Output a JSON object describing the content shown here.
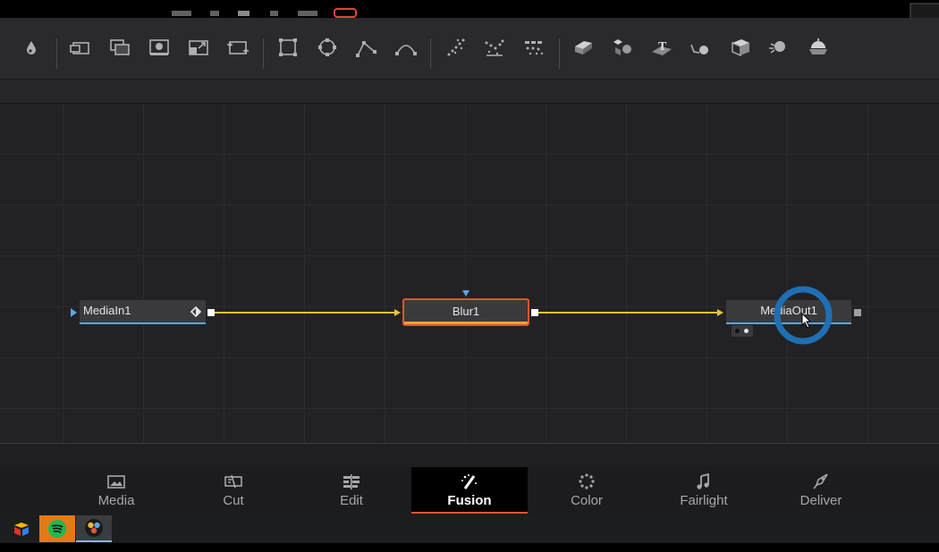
{
  "toolbar": {
    "icons": [
      "paint-drop-icon",
      "background-icon",
      "merge-icon",
      "mask-icon",
      "transform-icon",
      "resize-icon",
      "rectangle-mask-icon",
      "ellipse-mask-icon",
      "polygon-mask-icon",
      "bspline-mask-icon",
      "particle-emitter-icon",
      "particle-render-icon",
      "particle-system-icon",
      "shape3d-icon",
      "merge3d-icon",
      "text3d-icon",
      "renderer3d-icon",
      "camera3d-icon",
      "light3d-icon",
      "image-plane-icon"
    ]
  },
  "nodes": {
    "media_in": {
      "label": "MediaIn1"
    },
    "blur": {
      "label": "Blur1"
    },
    "media_out": {
      "label": "MediaOut1"
    }
  },
  "colors": {
    "connection": "#e8c23a",
    "node_selected_border": "#e0552f",
    "node_underline": "#5aa5e6",
    "cursor_ring": "#1f6fb4",
    "active_tab_underline": "#e0552f"
  },
  "page_tabs": [
    {
      "label": "Media",
      "icon": "media-icon"
    },
    {
      "label": "Cut",
      "icon": "cut-icon"
    },
    {
      "label": "Edit",
      "icon": "edit-icon"
    },
    {
      "label": "Fusion",
      "icon": "fusion-icon",
      "active": true
    },
    {
      "label": "Color",
      "icon": "color-icon"
    },
    {
      "label": "Fairlight",
      "icon": "fairlight-icon"
    },
    {
      "label": "Deliver",
      "icon": "deliver-icon"
    }
  ],
  "taskbar": {
    "apps": [
      "airtable-icon",
      "spotify-icon",
      "davinci-resolve-icon"
    ]
  }
}
